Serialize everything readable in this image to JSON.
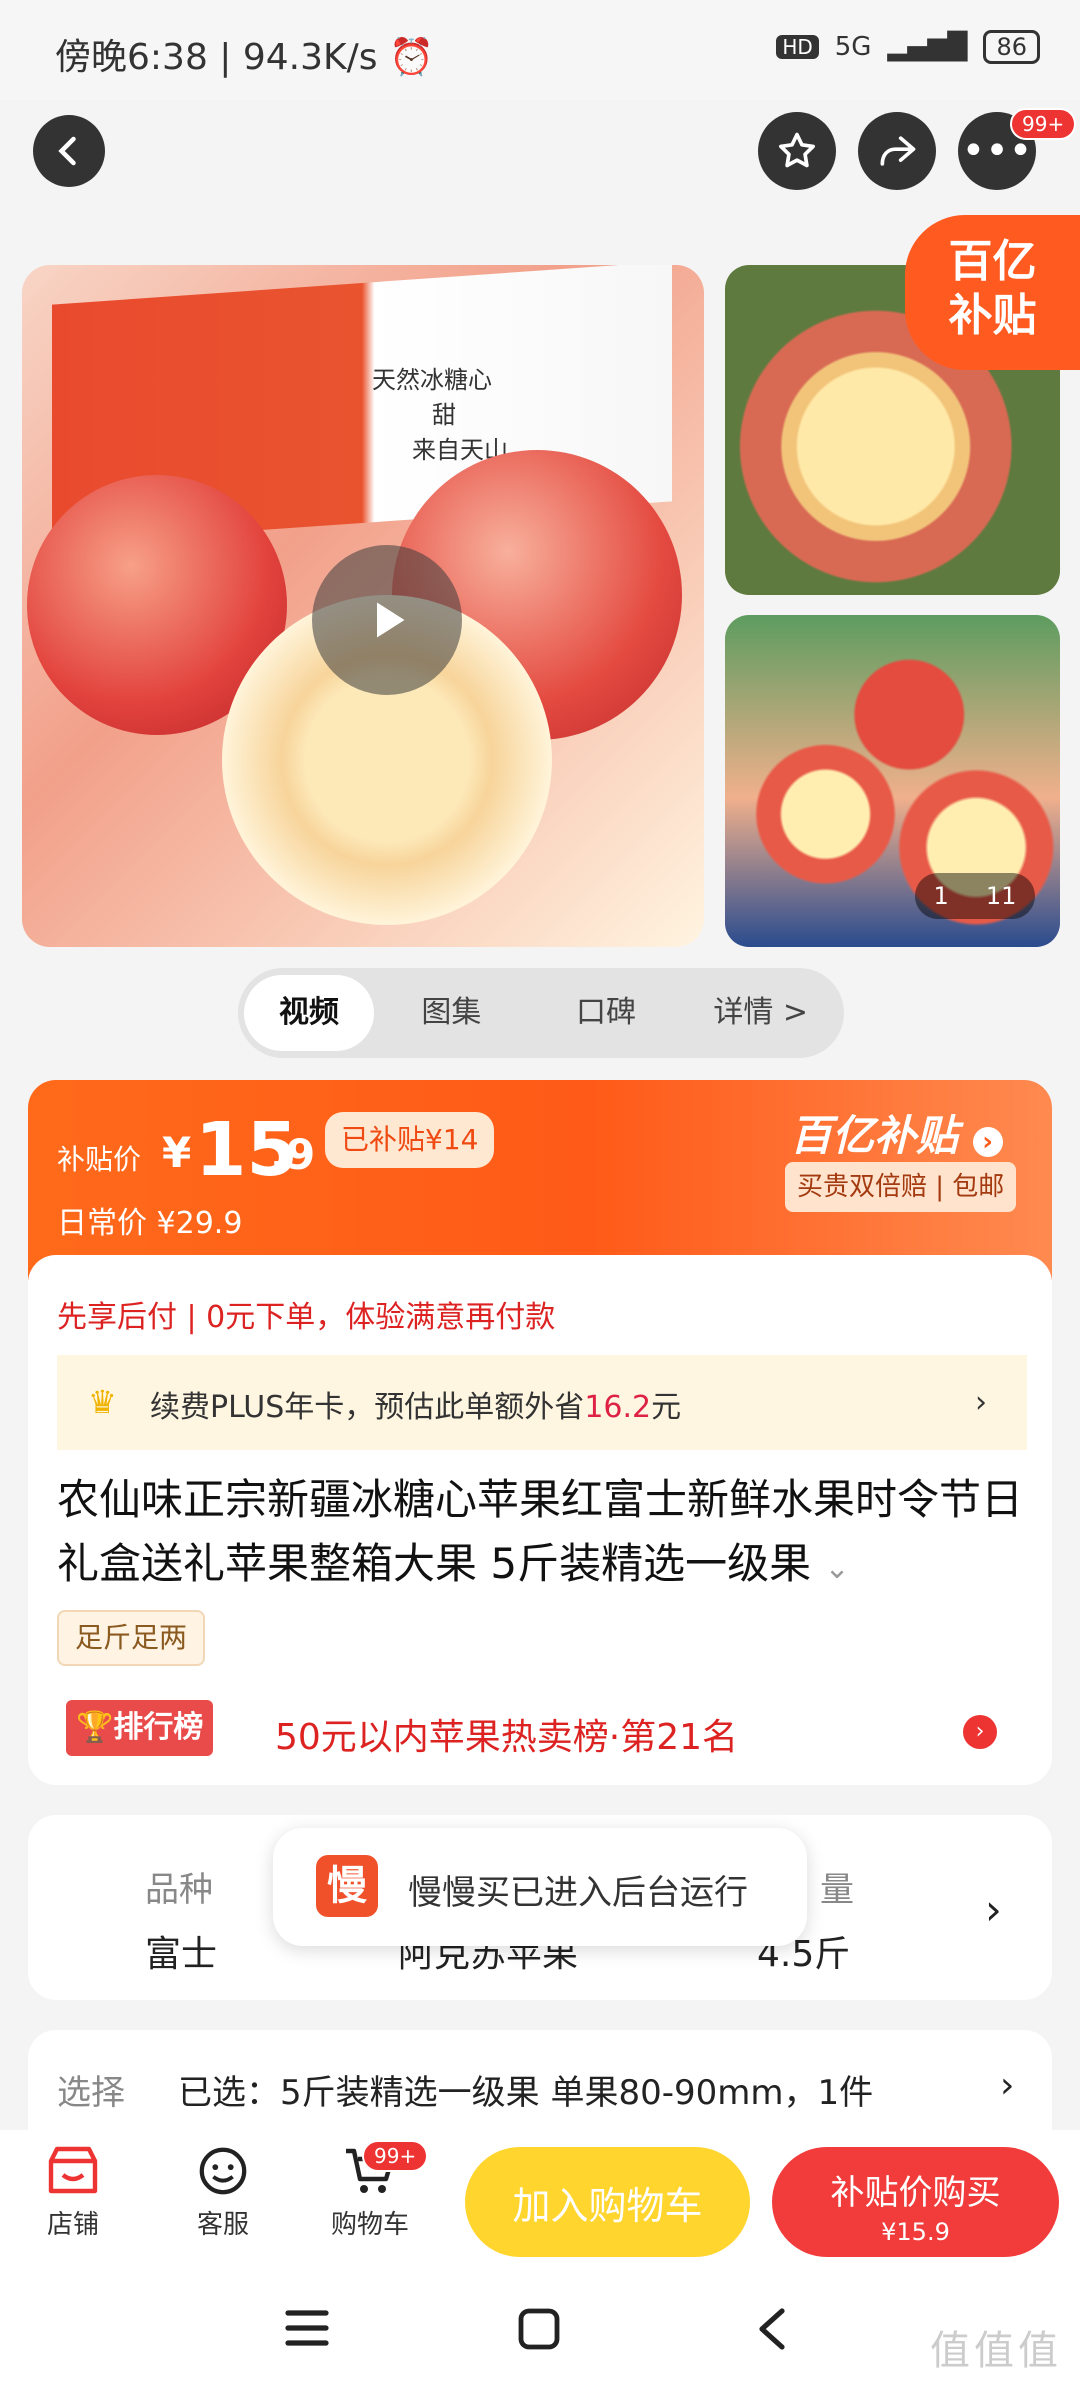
{
  "status_bar": {
    "time": "傍晚6:38 | 94.3K/s ⏰",
    "network": "HD",
    "signal": "5G",
    "battery": "86"
  },
  "nav": {
    "badge": "99+"
  },
  "gallery": {
    "corner_badge_line1": "百亿",
    "corner_badge_line2": "补贴",
    "counter_current": "1",
    "counter_total": "11"
  },
  "tabs": [
    "视频",
    "图集",
    "口碑",
    "详情 >"
  ],
  "price": {
    "label": "补贴价",
    "yen": "¥",
    "integer": "15",
    "decimal": ".9",
    "subsidized_tag": "已补贴¥14",
    "daily_price": "日常价 ¥29.9",
    "brand": "百亿补贴",
    "brand_sub": "买贵双倍赔 | 包邮"
  },
  "info": {
    "pay_later": "先享后付 | 0元下单，体验满意再付款",
    "plus_prefix": "续费PLUS年卡，预估此单额外省",
    "plus_amount": "16.2",
    "plus_suffix": "元",
    "title": "农仙味正宗新疆冰糖心苹果红富士新鲜水果时令节日礼盒送礼苹果整箱大果 5斤装精选一级果",
    "tag": "足斤足两",
    "rank_badge": "排行榜",
    "rank_text": "50元以内苹果热卖榜·第21名"
  },
  "specs": {
    "k1": "品种",
    "v1": "富士",
    "v2": "阿克苏苹果",
    "k3": "量",
    "v3": "4.5斤"
  },
  "toast": {
    "icon": "慢",
    "text": "慢慢买已进入后台运行"
  },
  "select": {
    "label": "选择",
    "value": "已选：5斤装精选一级果 单果80-90mm，1件"
  },
  "bottom": {
    "shop": "店铺",
    "service": "客服",
    "cart": "购物车",
    "cart_badge": "99+",
    "add_cart": "加入购物车",
    "buy": "补贴价购买",
    "buy_price": "¥15.9"
  },
  "box_text": [
    "天然冰糖心",
    "甜",
    "来自天山"
  ],
  "watermark": "值值值"
}
